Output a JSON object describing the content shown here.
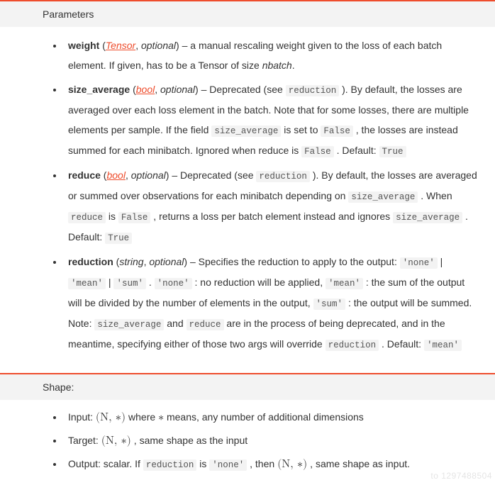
{
  "section1": {
    "title": "Parameters"
  },
  "params": {
    "weight": {
      "name": "weight",
      "type": "Tensor",
      "optional": "optional",
      "desc1": " – a manual rescaling weight given to the loss of each batch element. If given, has to be a Tensor of size ",
      "nbatch": "nbatch",
      "desc2": "."
    },
    "size_average": {
      "name": "size_average",
      "type": "bool",
      "optional": "optional",
      "d1": " – Deprecated (see ",
      "c_reduction": "reduction",
      "d2": " ). By default, the losses are averaged over each loss element in the batch. Note that for some losses, there are multiple elements per sample. If the field ",
      "c_sa": "size_average",
      "d3": " is set to ",
      "c_false1": "False",
      "d4": " , the losses are instead summed for each minibatch. Ignored when reduce is ",
      "c_false2": "False",
      "d5": " . Default: ",
      "c_true": "True"
    },
    "reduce": {
      "name": "reduce",
      "type": "bool",
      "optional": "optional",
      "d1": " – Deprecated (see ",
      "c_reduction": "reduction",
      "d2": " ). By default, the losses are averaged or summed over observations for each minibatch depending on ",
      "c_sa": "size_average",
      "d3": " . When ",
      "c_reduce": "reduce",
      "d4": " is ",
      "c_false": "False",
      "d5": " , returns a loss per batch element instead and ignores ",
      "c_sa2": "size_average",
      "d6": " . Default: ",
      "c_true": "True"
    },
    "reduction": {
      "name": "reduction",
      "type": "string",
      "optional": "optional",
      "d1": " – Specifies the reduction to apply to the output: ",
      "c_none1": "'none'",
      "d2": " | ",
      "c_mean1": "'mean'",
      "d3": " | ",
      "c_sum1": "'sum'",
      "d4": " . ",
      "c_none2": "'none'",
      "d5": " : no reduction will be applied, ",
      "c_mean2": "'mean'",
      "d6": " : the sum of the output will be divided by the number of elements in the output, ",
      "c_sum2": "'sum'",
      "d7": " : the output will be summed. Note: ",
      "c_sa": "size_average",
      "d8": " and ",
      "c_reduce": "reduce",
      "d9": " are in the process of being deprecated, and in the meantime, specifying either of those two args will override ",
      "c_reduction": "reduction",
      "d10": " . Default: ",
      "c_mean3": "'mean'"
    }
  },
  "section2": {
    "title": "Shape:"
  },
  "shape": {
    "input": {
      "label": "Input: ",
      "math": "(N, ∗)",
      "d1": " where ",
      "star": "∗",
      "d2": " means, any number of additional dimensions"
    },
    "target": {
      "label": "Target: ",
      "math": "(N, ∗)",
      "d1": " , same shape as the input"
    },
    "output": {
      "label": "Output: scalar. If ",
      "c_reduction": "reduction",
      "d1": " is ",
      "c_none": "'none'",
      "d2": " , then ",
      "math": "(N, ∗)",
      "d3": " , same shape as input."
    }
  },
  "watermark": "to 1297488504"
}
